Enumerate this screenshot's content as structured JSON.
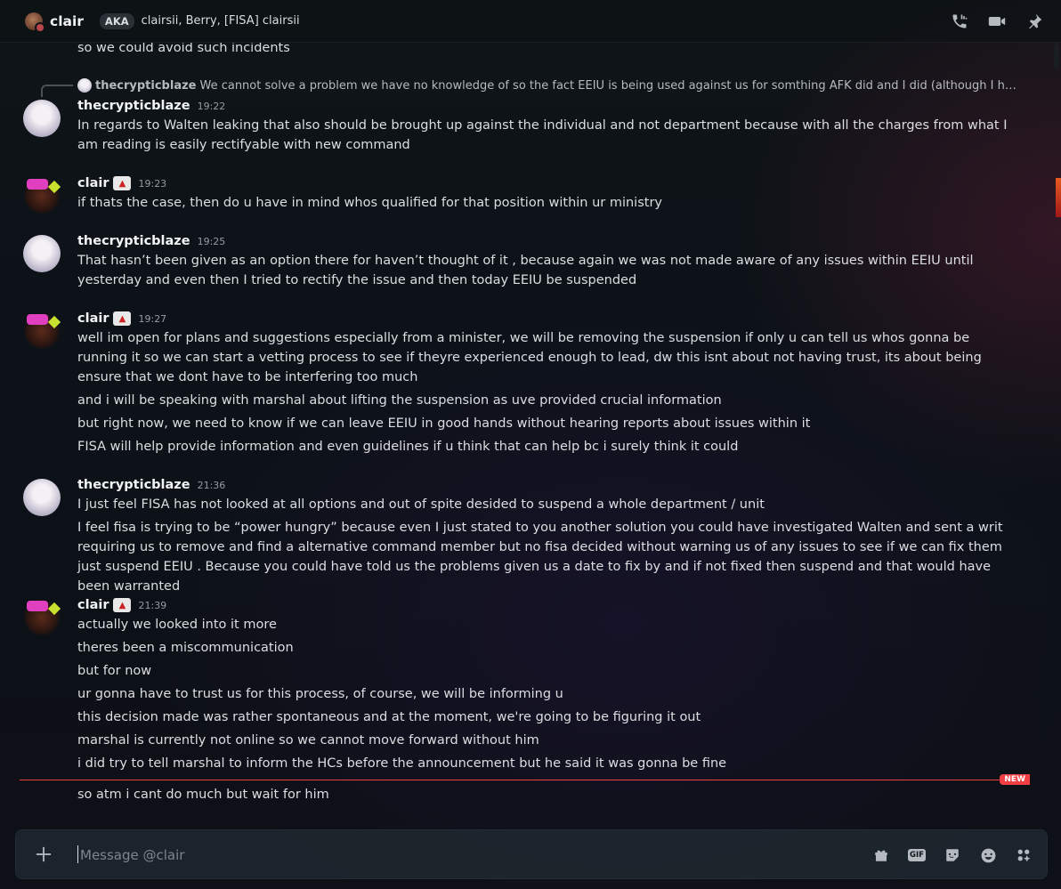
{
  "header": {
    "username": "clair",
    "aka_badge": "AKA",
    "aka_names": "clairsii, Berry, [FISA] clairsii",
    "icons": [
      "voice-call-icon",
      "video-call-icon",
      "pinned-messages-icon"
    ]
  },
  "colors": {
    "status_dot": "#b9464a",
    "new_divider": "#f23f43"
  },
  "cut_message": "so we could avoid such incidents",
  "reply": {
    "username": "thecrypticblaze",
    "text": "We cannot solve a problem we have no knowledge of so the fact EEIU  is being used against us for somthing AFK did and I did (although I have my reasonings ..."
  },
  "groups": [
    {
      "username": "thecrypticblaze",
      "time": "19:22",
      "messages": [
        "In regards to Walten leaking that also should be brought up against the individual and not department because with all the charges from what I am reading is easily rectifyable with new command"
      ]
    },
    {
      "username": "clair",
      "time": "19:23",
      "messages": [
        "if thats the case, then do u have in mind whos qualified for that position within ur ministry"
      ]
    },
    {
      "username": "thecrypticblaze",
      "time": "19:25",
      "messages": [
        "That hasn’t been given as an option there for haven’t thought of it , because again we was not made aware of any issues within EEIU until yesterday and even then I tried to rectify the issue and then today EEIU be suspended"
      ]
    },
    {
      "username": "clair",
      "time": "19:27",
      "messages": [
        "well im open for plans and suggestions especially from a minister, we will be removing the suspension if only u can tell us whos gonna be running it so we can start a vetting process to see if theyre experienced enough to lead, dw this isnt about not having trust, its about being ensure that we dont have to be interfering too much",
        "and i will be speaking with marshal about lifting the suspension as uve provided crucial information",
        "but right now, we need to know if we can leave EEIU in good hands without hearing reports about issues within it",
        "FISA will help provide information and even guidelines if u think that can help bc i surely think it could"
      ]
    },
    {
      "username": "thecrypticblaze",
      "time": "21:36",
      "messages": [
        "I just feel FISA has not looked at all options and out of spite desided to suspend a whole department / unit",
        "I feel fisa is trying to be “power hungry” because even I just stated to you another solution you could have investigated Walten and sent a writ requiring us to remove and find a alternative command member but no fisa decided without warning us of any issues to see if we can fix them just suspend EEIU . Because you could have told us the problems given us a date to fix by and if not fixed then suspend and that would have been warranted"
      ]
    },
    {
      "username": "clair",
      "time": "21:39",
      "messages": [
        "actually we looked into it more",
        "theres been a miscommunication",
        "but for now",
        "ur gonna have to trust us for this process, of course, we will be informing u",
        "this decision made was rather spontaneous and at the moment, we're going to be figuring it out",
        "marshal is currently not online so we cannot move forward without him",
        "i did try to tell marshal to inform the HCs before the announcement but he said it was gonna be fine"
      ]
    }
  ],
  "new_badge": "NEW",
  "after_new_message": "so atm i cant do much but wait for him",
  "composer": {
    "placeholder": "Message @clair",
    "gif_label": "GIF",
    "icons": [
      "add-attachment-icon",
      "gift-icon",
      "gif-icon",
      "sticker-icon",
      "emoji-icon",
      "apps-icon"
    ]
  }
}
